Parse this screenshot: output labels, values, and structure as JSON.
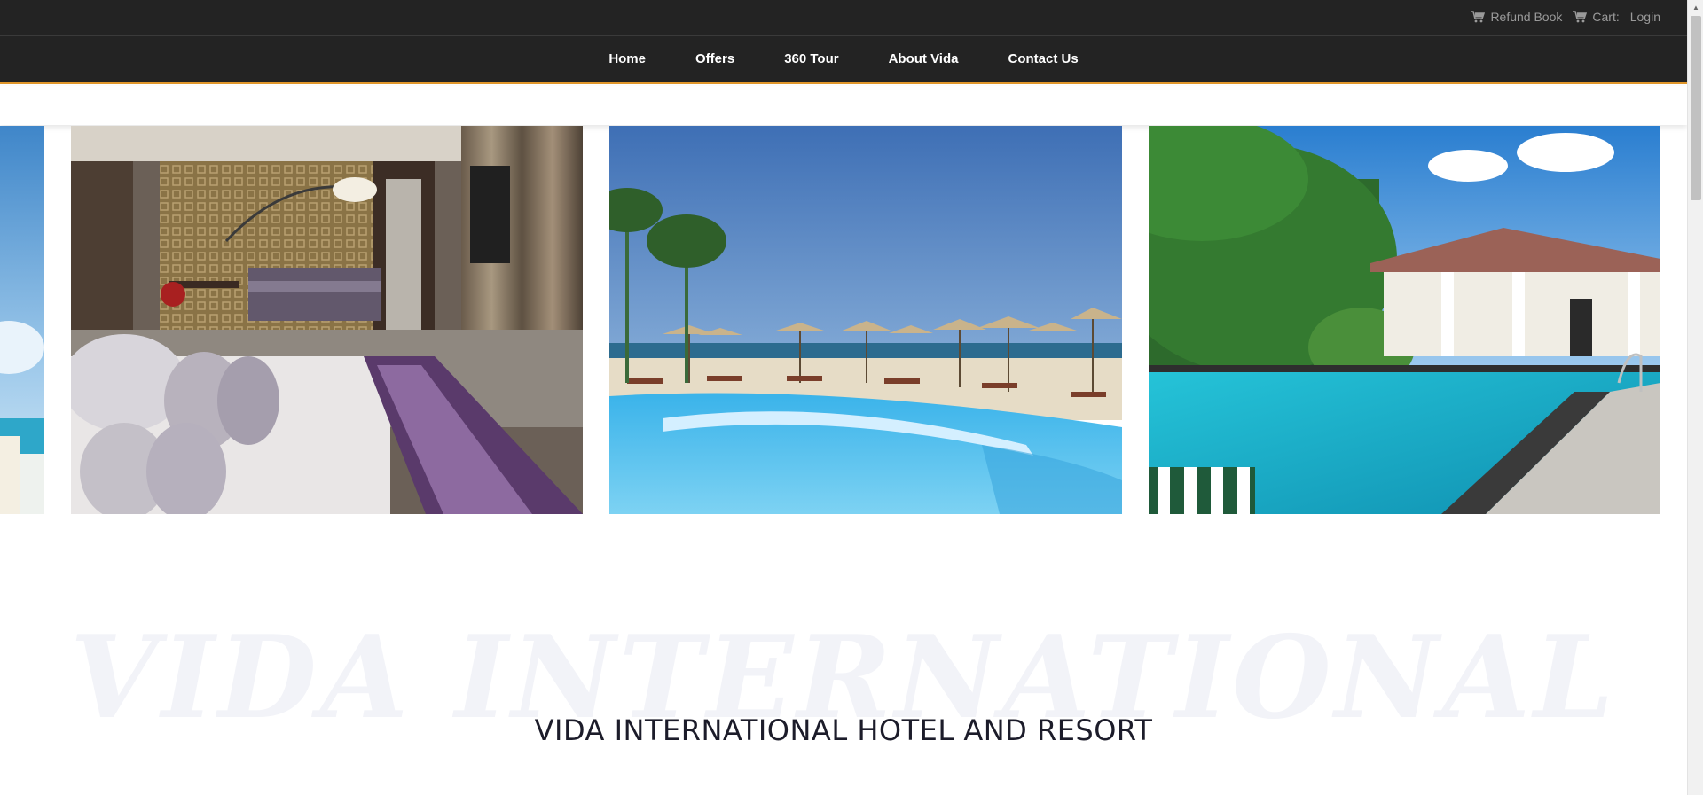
{
  "topbar": {
    "links": [
      {
        "label": "Refund Book",
        "icon": "cart-icon"
      },
      {
        "label": "Cart:",
        "icon": "cart-icon"
      },
      {
        "label": "Login",
        "icon": ""
      }
    ]
  },
  "nav": {
    "items": [
      "Home",
      "Offers",
      "360 Tour",
      "About Vida",
      "Contact Us"
    ],
    "accent_color": "#e0962a",
    "background_color": "#232323"
  },
  "carousel": {
    "slides": [
      {
        "subject": "beach-edge",
        "partial": true
      },
      {
        "subject": "hotel-bedroom"
      },
      {
        "subject": "beach-pool"
      },
      {
        "subject": "villa-pool"
      }
    ]
  },
  "hero": {
    "watermark": "VIDA INTERNATIONAL",
    "title": "VIDA INTERNATIONAL HOTEL AND RESORT"
  }
}
